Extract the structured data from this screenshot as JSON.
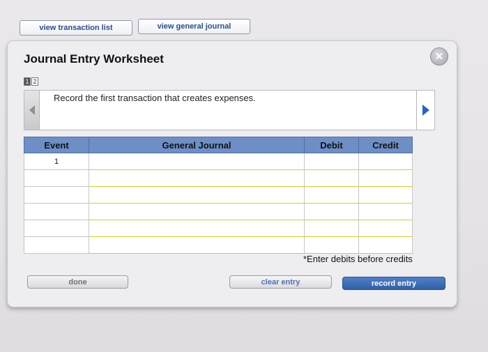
{
  "top_buttons": {
    "view_transaction_list": "view transaction list",
    "view_general_journal": "view general journal"
  },
  "worksheet": {
    "title": "Journal Entry Worksheet",
    "steps": [
      "1",
      "2"
    ],
    "active_step": 1,
    "prompt": "Record the first transaction that creates expenses.",
    "close_icon": "close-icon",
    "nav_left_icon": "arrow-left-icon",
    "nav_right_icon": "arrow-right-icon"
  },
  "table": {
    "headers": [
      "Event",
      "General Journal",
      "Debit",
      "Credit"
    ],
    "rows": [
      {
        "event": "1",
        "account": "",
        "debit": "",
        "credit": ""
      },
      {
        "event": "",
        "account": "",
        "debit": "",
        "credit": ""
      },
      {
        "event": "",
        "account": "",
        "debit": "",
        "credit": ""
      },
      {
        "event": "",
        "account": "",
        "debit": "",
        "credit": ""
      },
      {
        "event": "",
        "account": "",
        "debit": "",
        "credit": ""
      },
      {
        "event": "",
        "account": "",
        "debit": "",
        "credit": ""
      }
    ]
  },
  "note": "*Enter debits before credits",
  "actions": {
    "done": "done",
    "clear_entry": "clear entry",
    "record_entry": "record entry"
  },
  "colors": {
    "header_blue": "#6d8fc6",
    "record_button": "#2f5fa8",
    "input_line_yellow": "#d8cc34"
  }
}
